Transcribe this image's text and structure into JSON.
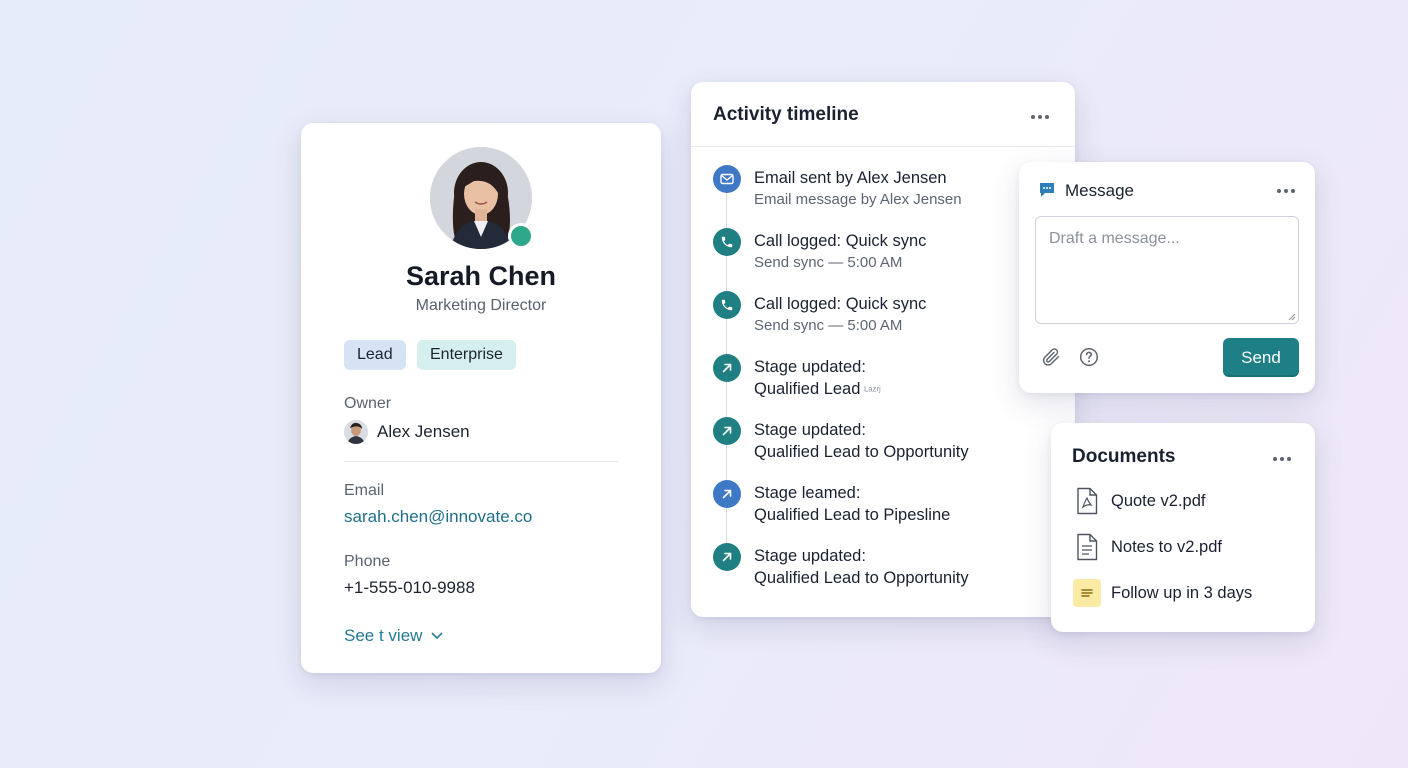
{
  "contact": {
    "name": "Sarah Chen",
    "title": "Marketing Director",
    "tags": [
      "Lead",
      "Enterprise"
    ],
    "owner_label": "Owner",
    "owner_name": "Alex Jensen",
    "email_label": "Email",
    "email": "sarah.chen@innovate.co",
    "phone_label": "Phone",
    "phone": "+1-555-010-9988",
    "see_view": "See t view",
    "status": "online"
  },
  "timeline": {
    "title": "Activity timeline",
    "items": [
      {
        "icon": "mail-icon",
        "color": "#3f78c4",
        "main": "Email sent by Alex Jensen",
        "sub": "Email message by Alex Jensen"
      },
      {
        "icon": "phone-icon",
        "color": "#1f7f83",
        "main": "Call logged: Quick sync",
        "sub": "Send sync — 5:00 AM"
      },
      {
        "icon": "phone-icon",
        "color": "#1f7f83",
        "main": "Call logged: Quick sync",
        "sub": "Send sync — 5:00 AM"
      },
      {
        "icon": "arrow-up-right-icon",
        "color": "#1f7f83",
        "main": "Stage updated:",
        "main2": "Qualified Lead",
        "small": "ᴸᵃᶻʳʲ"
      },
      {
        "icon": "arrow-up-right-icon",
        "color": "#1f7f83",
        "main": "Stage updated:",
        "main2": "Qualified Lead to Opportunity"
      },
      {
        "icon": "arrow-up-right-icon",
        "color": "#3f78c4",
        "main": "Stage leamed:",
        "main2": "Qualified Lead to Pipesline"
      },
      {
        "icon": "arrow-up-right-icon",
        "color": "#1f7f83",
        "main": "Stage updated:",
        "main2": "Qualified Lead to Opportunity"
      }
    ]
  },
  "message": {
    "title": "Message",
    "placeholder": "Draft a message...",
    "send_label": "Send"
  },
  "documents": {
    "title": "Documents",
    "items": [
      {
        "icon": "pdf-file-icon",
        "name": "Quote v2.pdf"
      },
      {
        "icon": "document-file-icon",
        "name": "Notes to v2.pdf"
      },
      {
        "icon": "note-icon",
        "name": "Follow up in 3 days"
      }
    ]
  },
  "colors": {
    "accent_teal": "#1f7f86",
    "accent_blue": "#3f78c4",
    "status_online": "#2ea88a",
    "link": "#1f6f8b"
  }
}
